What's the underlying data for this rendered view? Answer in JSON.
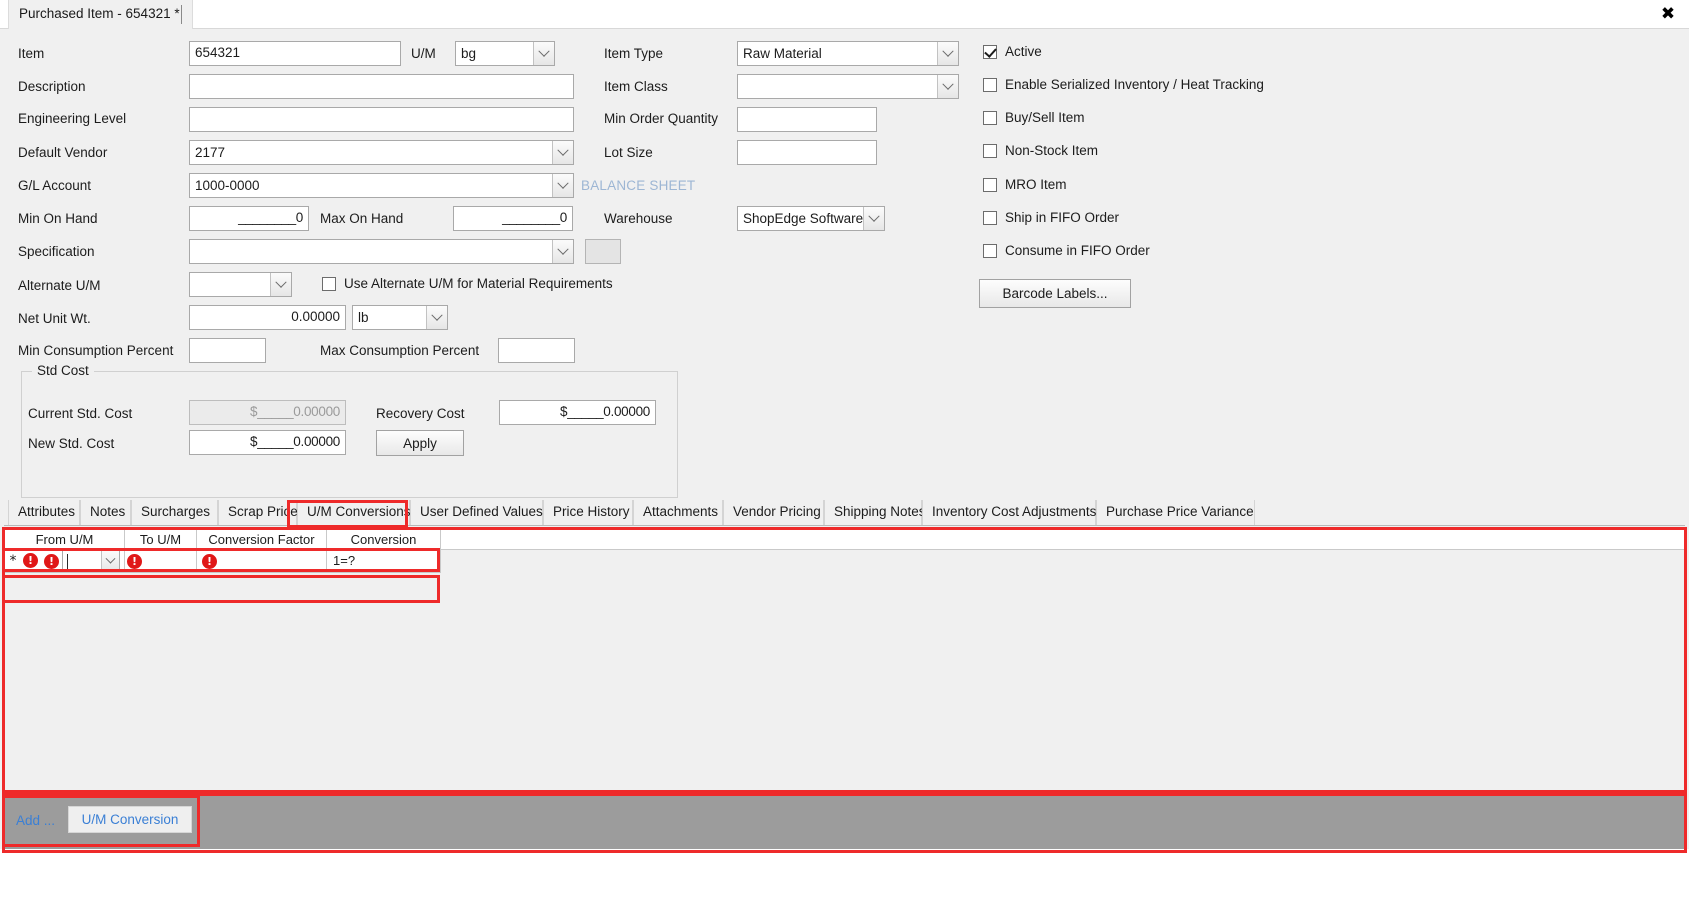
{
  "window": {
    "doc_tab_title": "Purchased Item - 654321 *",
    "close_icon": "close-icon"
  },
  "form": {
    "left_column": [
      {
        "label": "Item",
        "value": "654321"
      },
      {
        "label": "Description",
        "value": ""
      },
      {
        "label": "Engineering Level",
        "value": ""
      },
      {
        "label": "Default Vendor",
        "value": "2177"
      },
      {
        "label": "G/L Account",
        "value": "1000-0000"
      },
      {
        "label": "Min On Hand",
        "value": "________0"
      },
      {
        "label": "Max On Hand",
        "value": "________0"
      },
      {
        "label": "Specification",
        "value": ""
      },
      {
        "label": "Alternate U/M",
        "value": ""
      },
      {
        "label": "Net Unit Wt.",
        "value": "0.00000"
      },
      {
        "label": "Min Consumption Percent",
        "value": ""
      },
      {
        "label": "Max Consumption Percent",
        "value": ""
      }
    ],
    "um_label": "U/M",
    "um_value": "bg",
    "net_unit_wt_um": "lb",
    "use_alt_um_label": "Use Alternate U/M for Material Requirements",
    "use_alt_um_checked": false,
    "middle_column": [
      {
        "label": "Item Type",
        "value": "Raw Material"
      },
      {
        "label": "Item Class",
        "value": ""
      },
      {
        "label": "Min Order Quantity",
        "value": ""
      },
      {
        "label": "Lot Size",
        "value": ""
      },
      {
        "label": "Warehouse",
        "value": "ShopEdge Software"
      }
    ],
    "balance_sheet_text": "BALANCE SHEET",
    "checkboxes": [
      {
        "label": "Active",
        "checked": true
      },
      {
        "label": "Enable Serialized Inventory / Heat Tracking",
        "checked": false
      },
      {
        "label": "Buy/Sell Item",
        "checked": false
      },
      {
        "label": "Non-Stock Item",
        "checked": false
      },
      {
        "label": "MRO Item",
        "checked": false
      },
      {
        "label": "Ship in FIFO Order",
        "checked": false
      },
      {
        "label": "Consume in FIFO Order",
        "checked": false
      }
    ],
    "barcode_button": "Barcode Labels...",
    "std_cost": {
      "title": "Std Cost",
      "current_label": "Current Std. Cost",
      "current_value": "$_____0.00000",
      "new_label": "New Std. Cost",
      "new_value": "$_____0.00000",
      "recovery_label": "Recovery Cost",
      "recovery_value": "$_____0.00000",
      "apply_button": "Apply"
    }
  },
  "tabs": {
    "items": [
      "Attributes",
      "Notes",
      "Surcharges",
      "Scrap Price",
      "U/M Conversions",
      "User Defined Values",
      "Price History",
      "Attachments",
      "Vendor Pricing",
      "Shipping Notes",
      "Inventory Cost Adjustments",
      "Purchase Price Variance"
    ],
    "selected": "U/M Conversions"
  },
  "grid": {
    "columns": [
      "From U/M",
      "To U/M",
      "Conversion Factor",
      "Conversion"
    ],
    "rows": [
      {
        "marker": "*",
        "row_error": "!",
        "from_um_error": "!",
        "from_um": "",
        "to_um_error": "!",
        "to_um": "",
        "conversion_factor_error": "!",
        "conversion_factor": "",
        "conversion": "1=?"
      }
    ]
  },
  "bottom_bar": {
    "add_link": "Add ...",
    "um_conversion_button": "U/M Conversion"
  },
  "colors": {
    "annotation_red": "#ee2a2a",
    "error_red": "#e01818",
    "link_blue": "#3a7fd5",
    "balance_sheet_blue": "#9db6d4",
    "bottom_bar_gray": "#9c9c9c"
  }
}
